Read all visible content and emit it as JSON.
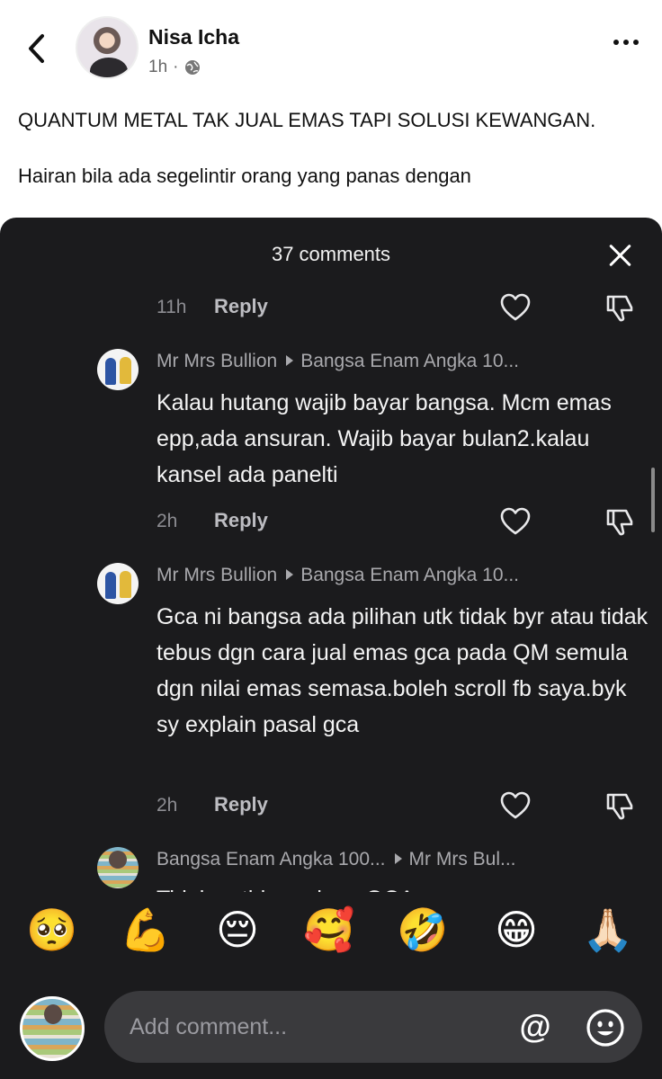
{
  "post": {
    "author": "Nisa Icha",
    "time": "1h",
    "dot": "·",
    "text_line1": "QUANTUM METAL TAK JUAL EMAS TAPI SOLUSI KEWANGAN.",
    "text_line2": "Hairan bila ada segelintir orang yang panas dengan"
  },
  "sheet": {
    "title": "37 comments"
  },
  "comments": [
    {
      "time": "11h",
      "reply_label": "Reply"
    },
    {
      "author": "Mr Mrs Bullion",
      "reply_to": "Bangsa Enam Angka 10...",
      "body": "Kalau hutang wajib bayar bangsa. Mcm emas epp,ada ansuran. Wajib bayar bulan2.kalau kansel ada panelti",
      "time": "2h",
      "reply_label": "Reply"
    },
    {
      "author": "Mr Mrs Bullion",
      "reply_to": "Bangsa Enam Angka 10...",
      "body": "Gca ni bangsa ada pilihan utk tidak byr atau tidak tebus dgn cara jual emas gca pada QM semula dgn nilai emas semasa.boleh scroll fb saya.byk sy explain pasal gca",
      "time": "2h",
      "reply_label": "Reply"
    },
    {
      "author": "Bangsa Enam Angka 100...",
      "reply_to": "Mr Mrs Bul...",
      "body_partial": "Tidak ... tid ... ada ... GCA ..."
    }
  ],
  "emoji_bar": [
    "🥺",
    "💪",
    "😔",
    "🥰",
    "🤣",
    "😁",
    "🙏🏻"
  ],
  "composer": {
    "placeholder": "Add comment...",
    "mention_symbol": "@"
  },
  "icons": {
    "back": "chevron-left-icon",
    "more": "more-dots-icon",
    "globe": "globe-icon",
    "close": "close-icon",
    "like": "heart-outline-icon",
    "dislike": "thumbs-down-icon",
    "mention": "at-sign-icon",
    "emoji": "smiley-icon"
  },
  "colors": {
    "sheet_bg": "#1b1b1d",
    "input_bg": "#3a3a3d",
    "muted_text": "#a9a9ad"
  }
}
